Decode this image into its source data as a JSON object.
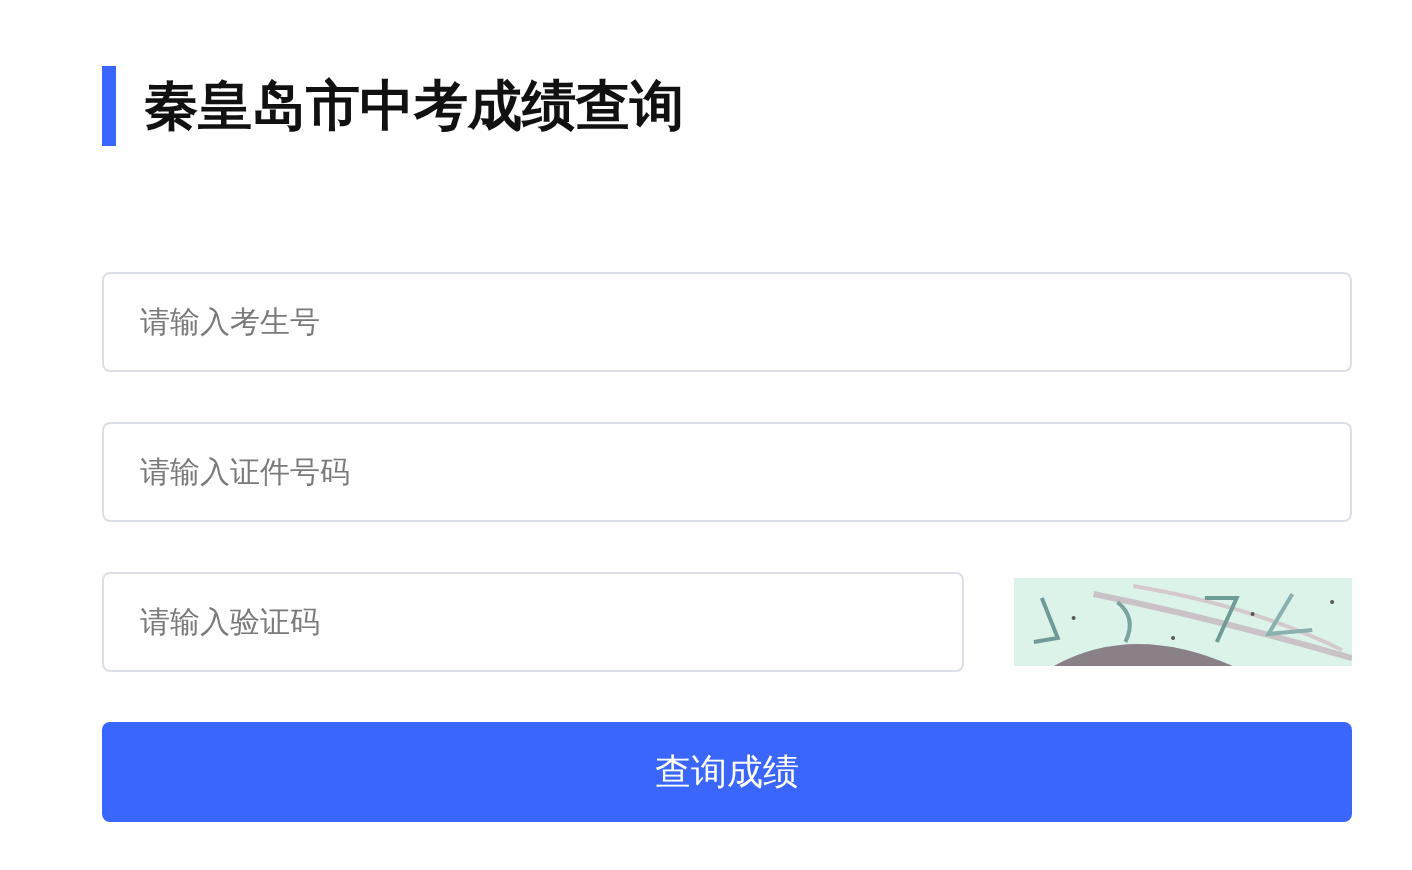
{
  "title": "秦皇岛市中考成绩查询",
  "fields": [
    {
      "placeholder": "请输入考生号"
    },
    {
      "placeholder": "请输入证件号码"
    }
  ],
  "captcha": {
    "placeholder": "请输入验证码"
  },
  "submit": {
    "label": "查询成绩"
  }
}
